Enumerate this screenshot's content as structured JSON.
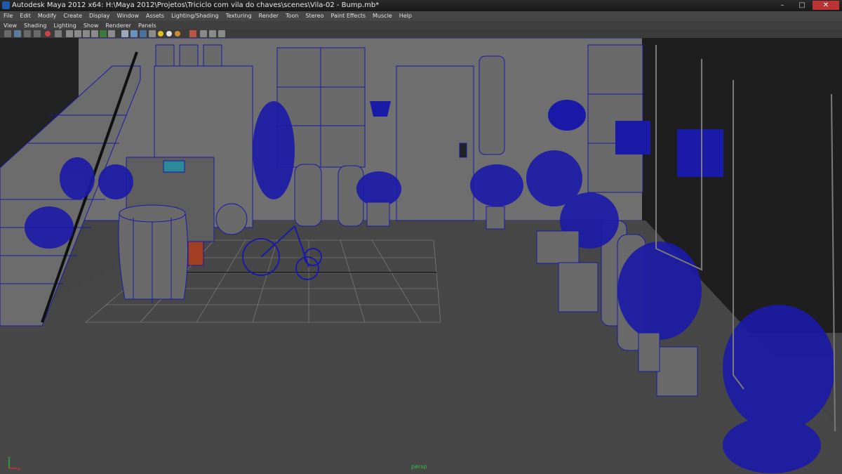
{
  "window": {
    "title": "Autodesk Maya 2012 x64: H:\\Maya 2012\\Projetos\\Triciclo com vila do chaves\\scenes\\Vila-02 - Bump.mb*",
    "minimize": "–",
    "maximize": "□",
    "close": "✕"
  },
  "menu": [
    "File",
    "Edit",
    "Modify",
    "Create",
    "Display",
    "Window",
    "Assets",
    "Lighting/Shading",
    "Texturing",
    "Render",
    "Toon",
    "Stereo",
    "Paint Effects",
    "Muscle",
    "Help"
  ],
  "panel_menu": [
    "View",
    "Shading",
    "Lighting",
    "Show",
    "Renderer",
    "Panels"
  ],
  "viewport": {
    "camera": "persp",
    "axis_y": "y",
    "axis_x": "x",
    "colors": {
      "wire": "#1a1aa8",
      "background": "#444444",
      "grid": "#8a8a8a",
      "camera_label": "#36c23e"
    }
  }
}
